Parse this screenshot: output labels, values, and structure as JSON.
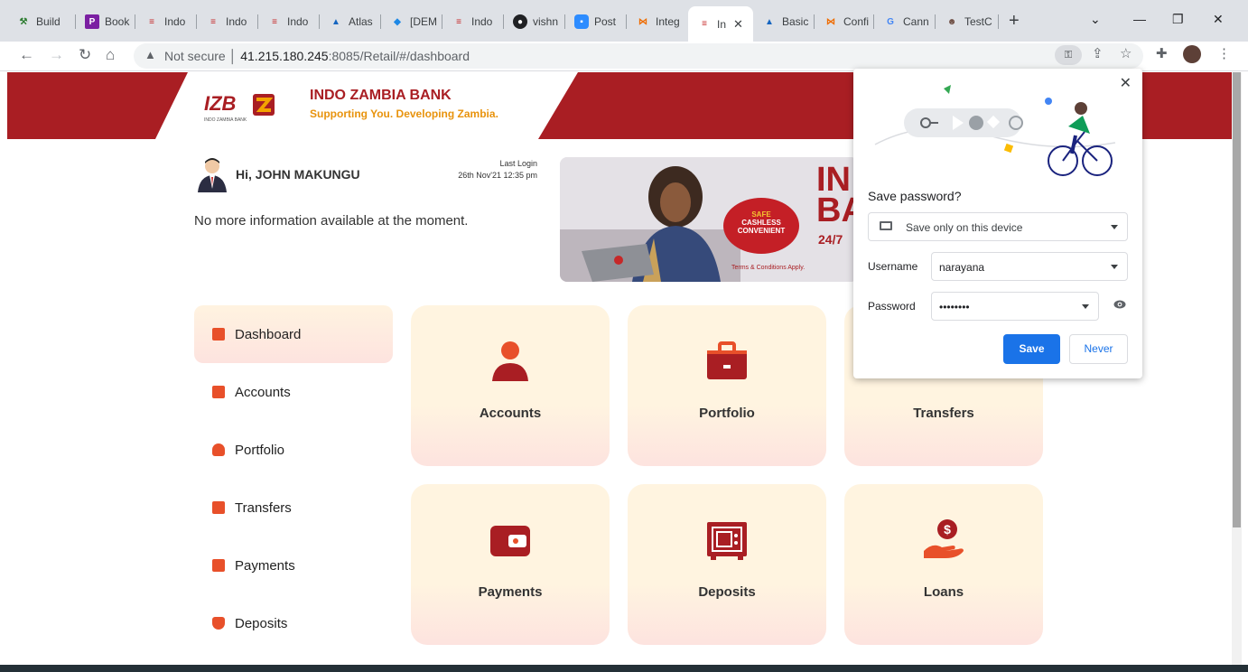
{
  "browser": {
    "tabs": [
      {
        "label": "Build",
        "icon": "tool-favicon",
        "color": "#2e7d32"
      },
      {
        "label": "Book",
        "icon": "p-favicon",
        "color": "#7b1fa2"
      },
      {
        "label": "Indo",
        "icon": "izb-favicon",
        "color": "#c62828"
      },
      {
        "label": "Indo",
        "icon": "izb-favicon",
        "color": "#c62828"
      },
      {
        "label": "Indo",
        "icon": "izb-favicon",
        "color": "#c62828"
      },
      {
        "label": "Atlas",
        "icon": "atlassian-favicon",
        "color": "#1565c0"
      },
      {
        "label": "[DEM",
        "icon": "jira-favicon",
        "color": "#1e88e5"
      },
      {
        "label": "Indo",
        "icon": "izb-favicon",
        "color": "#c62828"
      },
      {
        "label": "vishn",
        "icon": "github-favicon",
        "color": "#202124"
      },
      {
        "label": "Post",
        "icon": "zoom-favicon",
        "color": "#2d8cff"
      },
      {
        "label": "Integ",
        "icon": "postman-favicon",
        "color": "#ef6c00"
      },
      {
        "label": "In",
        "icon": "izb-favicon",
        "color": "#c62828",
        "active": true
      },
      {
        "label": "Basic",
        "icon": "atlassian-favicon",
        "color": "#1565c0"
      },
      {
        "label": "Confi",
        "icon": "postman-favicon",
        "color": "#ef6c00"
      },
      {
        "label": "Cann",
        "icon": "google-favicon",
        "color": "#4285f4"
      },
      {
        "label": "TestC",
        "icon": "avatar-favicon",
        "color": "#6d4c41"
      }
    ],
    "url": {
      "security": "Not secure",
      "host": "41.215.180.245",
      "rest": ":8085/Retail/#/dashboard"
    }
  },
  "bank": {
    "logo": "IZB",
    "logo_sub": "INDO ZAMBIA BANK",
    "name": "INDO ZAMBIA BANK",
    "tagline": "Supporting You. Developing Zambia."
  },
  "user": {
    "greeting": "Hi, JOHN MAKUNGU",
    "last_login_label": "Last Login",
    "last_login_value": "26th Nov'21  12:35 pm",
    "info": "No more information available at the moment."
  },
  "promo": {
    "headline_1": "IN",
    "headline_2": "BA",
    "sub": "24/7",
    "badge_1": "SAFE",
    "badge_2": "CASHLESS",
    "badge_3": "CONVENIENT",
    "terms": "Terms & Conditions Apply."
  },
  "sidebar": {
    "items": [
      {
        "label": "Dashboard",
        "active": true
      },
      {
        "label": "Accounts"
      },
      {
        "label": "Portfolio"
      },
      {
        "label": "Transfers"
      },
      {
        "label": "Payments"
      },
      {
        "label": "Deposits"
      }
    ]
  },
  "tiles": [
    {
      "label": "Accounts",
      "icon": "user-icon"
    },
    {
      "label": "Portfolio",
      "icon": "briefcase-icon"
    },
    {
      "label": "Transfers",
      "icon": "transfer-icon"
    },
    {
      "label": "Payments",
      "icon": "wallet-icon"
    },
    {
      "label": "Deposits",
      "icon": "safe-icon"
    },
    {
      "label": "Loans",
      "icon": "loan-icon"
    }
  ],
  "password_popup": {
    "title": "Save password?",
    "storage_option": "Save only on this device",
    "username_label": "Username",
    "username_value": "narayana",
    "password_label": "Password",
    "password_value": "••••••••",
    "save_label": "Save",
    "never_label": "Never"
  },
  "colors": {
    "brand": "#a91e23",
    "accent_orange": "#e8502a",
    "tagline": "#e8930d",
    "primary_blue": "#1a73e8"
  }
}
